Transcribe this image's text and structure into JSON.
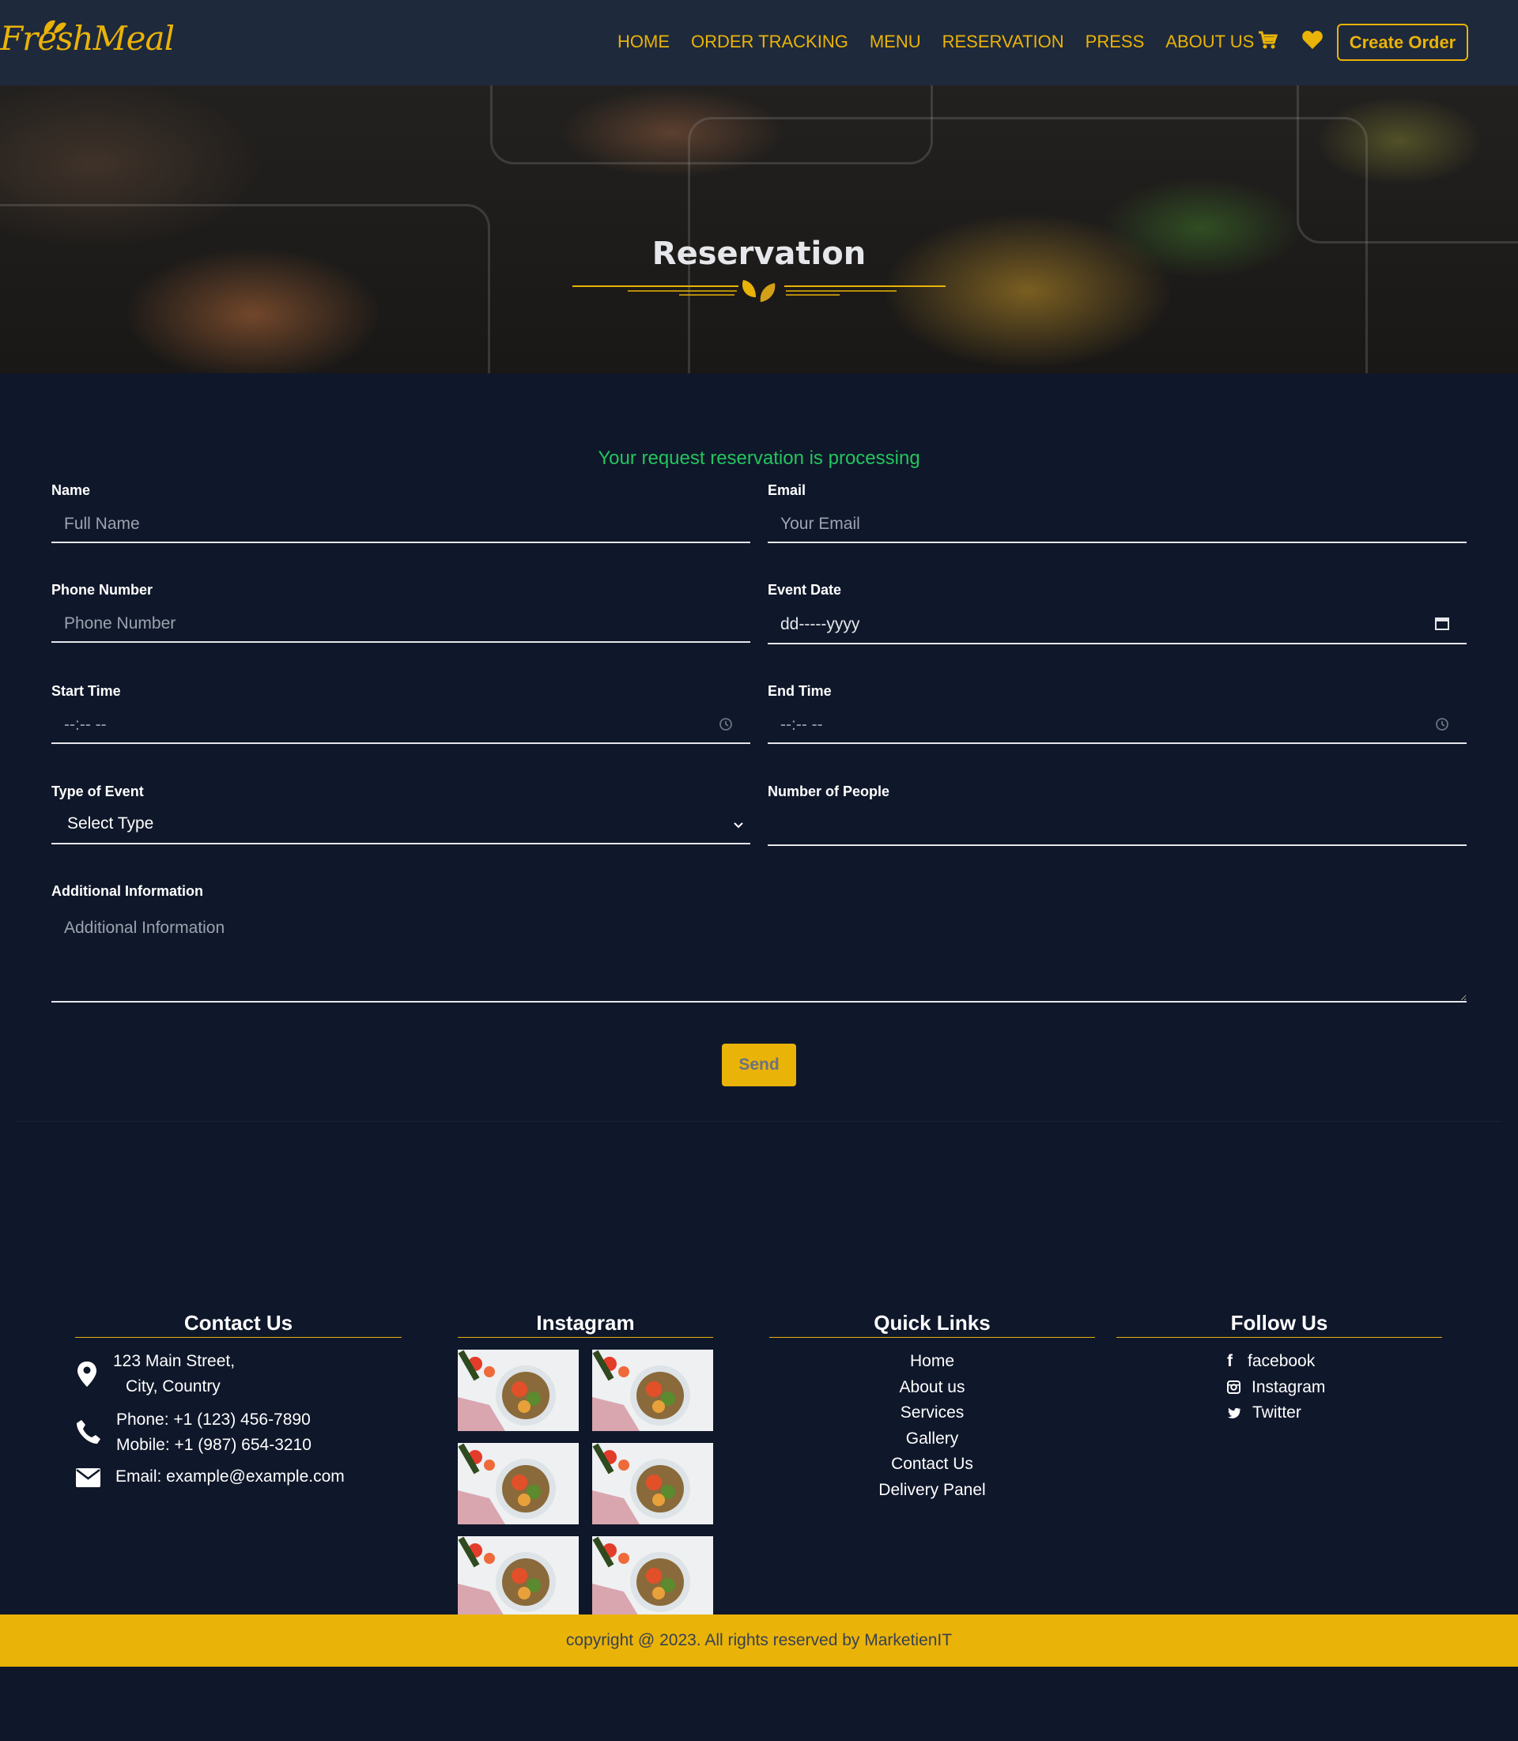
{
  "brand": {
    "logo_text": "FreshMeal",
    "accent_color": "#eab308",
    "background": "#0f172a"
  },
  "nav": {
    "links": [
      "HOME",
      "ORDER TRACKING",
      "MENU",
      "RESERVATION",
      "PRESS",
      "ABOUT US"
    ],
    "cart_icon": "cart-icon",
    "heart_icon": "heart-icon",
    "create_order_label": "Create Order"
  },
  "hero": {
    "title": "Reservation"
  },
  "form": {
    "status_message": "Your request reservation is processing",
    "status_color": "#22c55e",
    "name": {
      "label": "Name",
      "placeholder": "Full Name"
    },
    "email": {
      "label": "Email",
      "placeholder": "Your Email"
    },
    "phone": {
      "label": "Phone Number",
      "placeholder": "Phone Number"
    },
    "event_date": {
      "label": "Event Date",
      "value": "dd-----yyyy"
    },
    "start_time": {
      "label": "Start Time",
      "value": "--:-- --"
    },
    "end_time": {
      "label": "End Time",
      "value": "--:-- --"
    },
    "event_type": {
      "label": "Type of Event",
      "selected": "Select Type"
    },
    "people": {
      "label": "Number of People",
      "value": ""
    },
    "additional": {
      "label": "Additional Information",
      "placeholder": "Additional Information"
    },
    "send_label": "Send"
  },
  "footer": {
    "contact": {
      "title": "Contact Us",
      "address_line1": "123 Main Street,",
      "address_line2": "City, Country",
      "phone": "Phone: +1 (123) 456-7890",
      "mobile": "Mobile: +1 (987) 654-3210",
      "email": "Email: example@example.com"
    },
    "instagram": {
      "title": "Instagram"
    },
    "quick_links": {
      "title": "Quick Links",
      "items": [
        "Home",
        "About us",
        "Services",
        "Gallery",
        "Contact Us",
        "Delivery Panel"
      ]
    },
    "follow": {
      "title": "Follow Us",
      "items": [
        "facebook",
        "Instagram",
        "Twitter"
      ]
    },
    "copyright": "copyright @ 2023. All rights reserved by MarketienIT"
  }
}
